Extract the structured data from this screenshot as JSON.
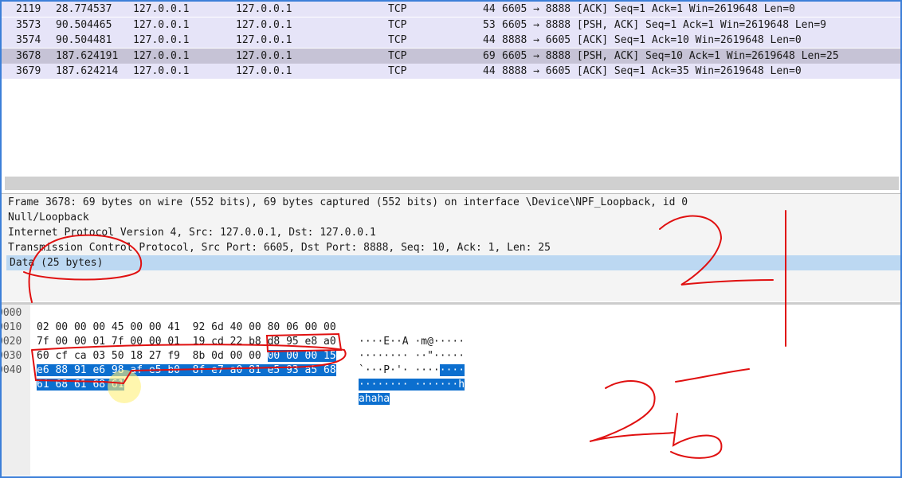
{
  "packet_list": {
    "rows": [
      {
        "no": "2119",
        "time": "28.774537",
        "src": "127.0.0.1",
        "dst": "127.0.0.1",
        "proto": "TCP",
        "len": "44",
        "info": "6605 → 8888 [ACK] Seq=1 Ack=1 Win=2619648 Len=0"
      },
      {
        "no": "3573",
        "time": "90.504465",
        "src": "127.0.0.1",
        "dst": "127.0.0.1",
        "proto": "TCP",
        "len": "53",
        "info": "6605 → 8888 [PSH, ACK] Seq=1 Ack=1 Win=2619648 Len=9"
      },
      {
        "no": "3574",
        "time": "90.504481",
        "src": "127.0.0.1",
        "dst": "127.0.0.1",
        "proto": "TCP",
        "len": "44",
        "info": "8888 → 6605 [ACK] Seq=1 Ack=10 Win=2619648 Len=0"
      },
      {
        "no": "3678",
        "time": "187.624191",
        "src": "127.0.0.1",
        "dst": "127.0.0.1",
        "proto": "TCP",
        "len": "69",
        "info": "6605 → 8888 [PSH, ACK] Seq=10 Ack=1 Win=2619648 Len=25"
      },
      {
        "no": "3679",
        "time": "187.624214",
        "src": "127.0.0.1",
        "dst": "127.0.0.1",
        "proto": "TCP",
        "len": "44",
        "info": "8888 → 6605 [ACK] Seq=1 Ack=35 Win=2619648 Len=0"
      }
    ],
    "selected_index": 3
  },
  "details": {
    "lines": [
      "Frame 3678: 69 bytes on wire (552 bits), 69 bytes captured (552 bits) on interface \\Device\\NPF_Loopback, id 0",
      "Null/Loopback",
      "Internet Protocol Version 4, Src: 127.0.0.1, Dst: 127.0.0.1",
      "Transmission Control Protocol, Src Port: 6605, Dst Port: 8888, Seq: 10, Ack: 1, Len: 25",
      "Data (25 bytes)"
    ],
    "selected_index": 4
  },
  "hex": {
    "rows": [
      {
        "offset": "0000",
        "hex": "02 00 00 00 45 00 00 41  92 6d 40 00 80 06 00 00",
        "hex_sel": "",
        "ascii": "····E··A ·m@·····",
        "ascii_sel": ""
      },
      {
        "offset": "0010",
        "hex": "7f 00 00 01 7f 00 00 01  19 cd 22 b8 d8 95 e8 a0",
        "hex_sel": "",
        "ascii": "········ ··\"·····",
        "ascii_sel": ""
      },
      {
        "offset": "0020",
        "hex": "60 cf ca 03 50 18 27 f9  8b 0d 00 00 ",
        "hex_sel": "00 00 00 15",
        "ascii": "`···P·'· ····",
        "ascii_sel": "····"
      },
      {
        "offset": "0030",
        "hex": "",
        "hex_sel": "e6 88 91 e6 98 af e5 b0  8f e7 a0 81 e5 93 a5 68",
        "ascii": "",
        "ascii_sel": "········ ·······h"
      },
      {
        "offset": "0040",
        "hex": "",
        "hex_sel": "61 68 61 68 61",
        "ascii": "",
        "ascii_sel": "ahaha"
      }
    ]
  },
  "annotations": {
    "handwritten": [
      "2",
      "25"
    ],
    "ink_color": "#e01010"
  },
  "colors": {
    "row_bg": "#e6e4f8",
    "row_selected": "#c6c3d6",
    "detail_selected": "#bcd8f2",
    "hex_selected": "#0c6fcf",
    "frame": "#3c7fd8"
  }
}
